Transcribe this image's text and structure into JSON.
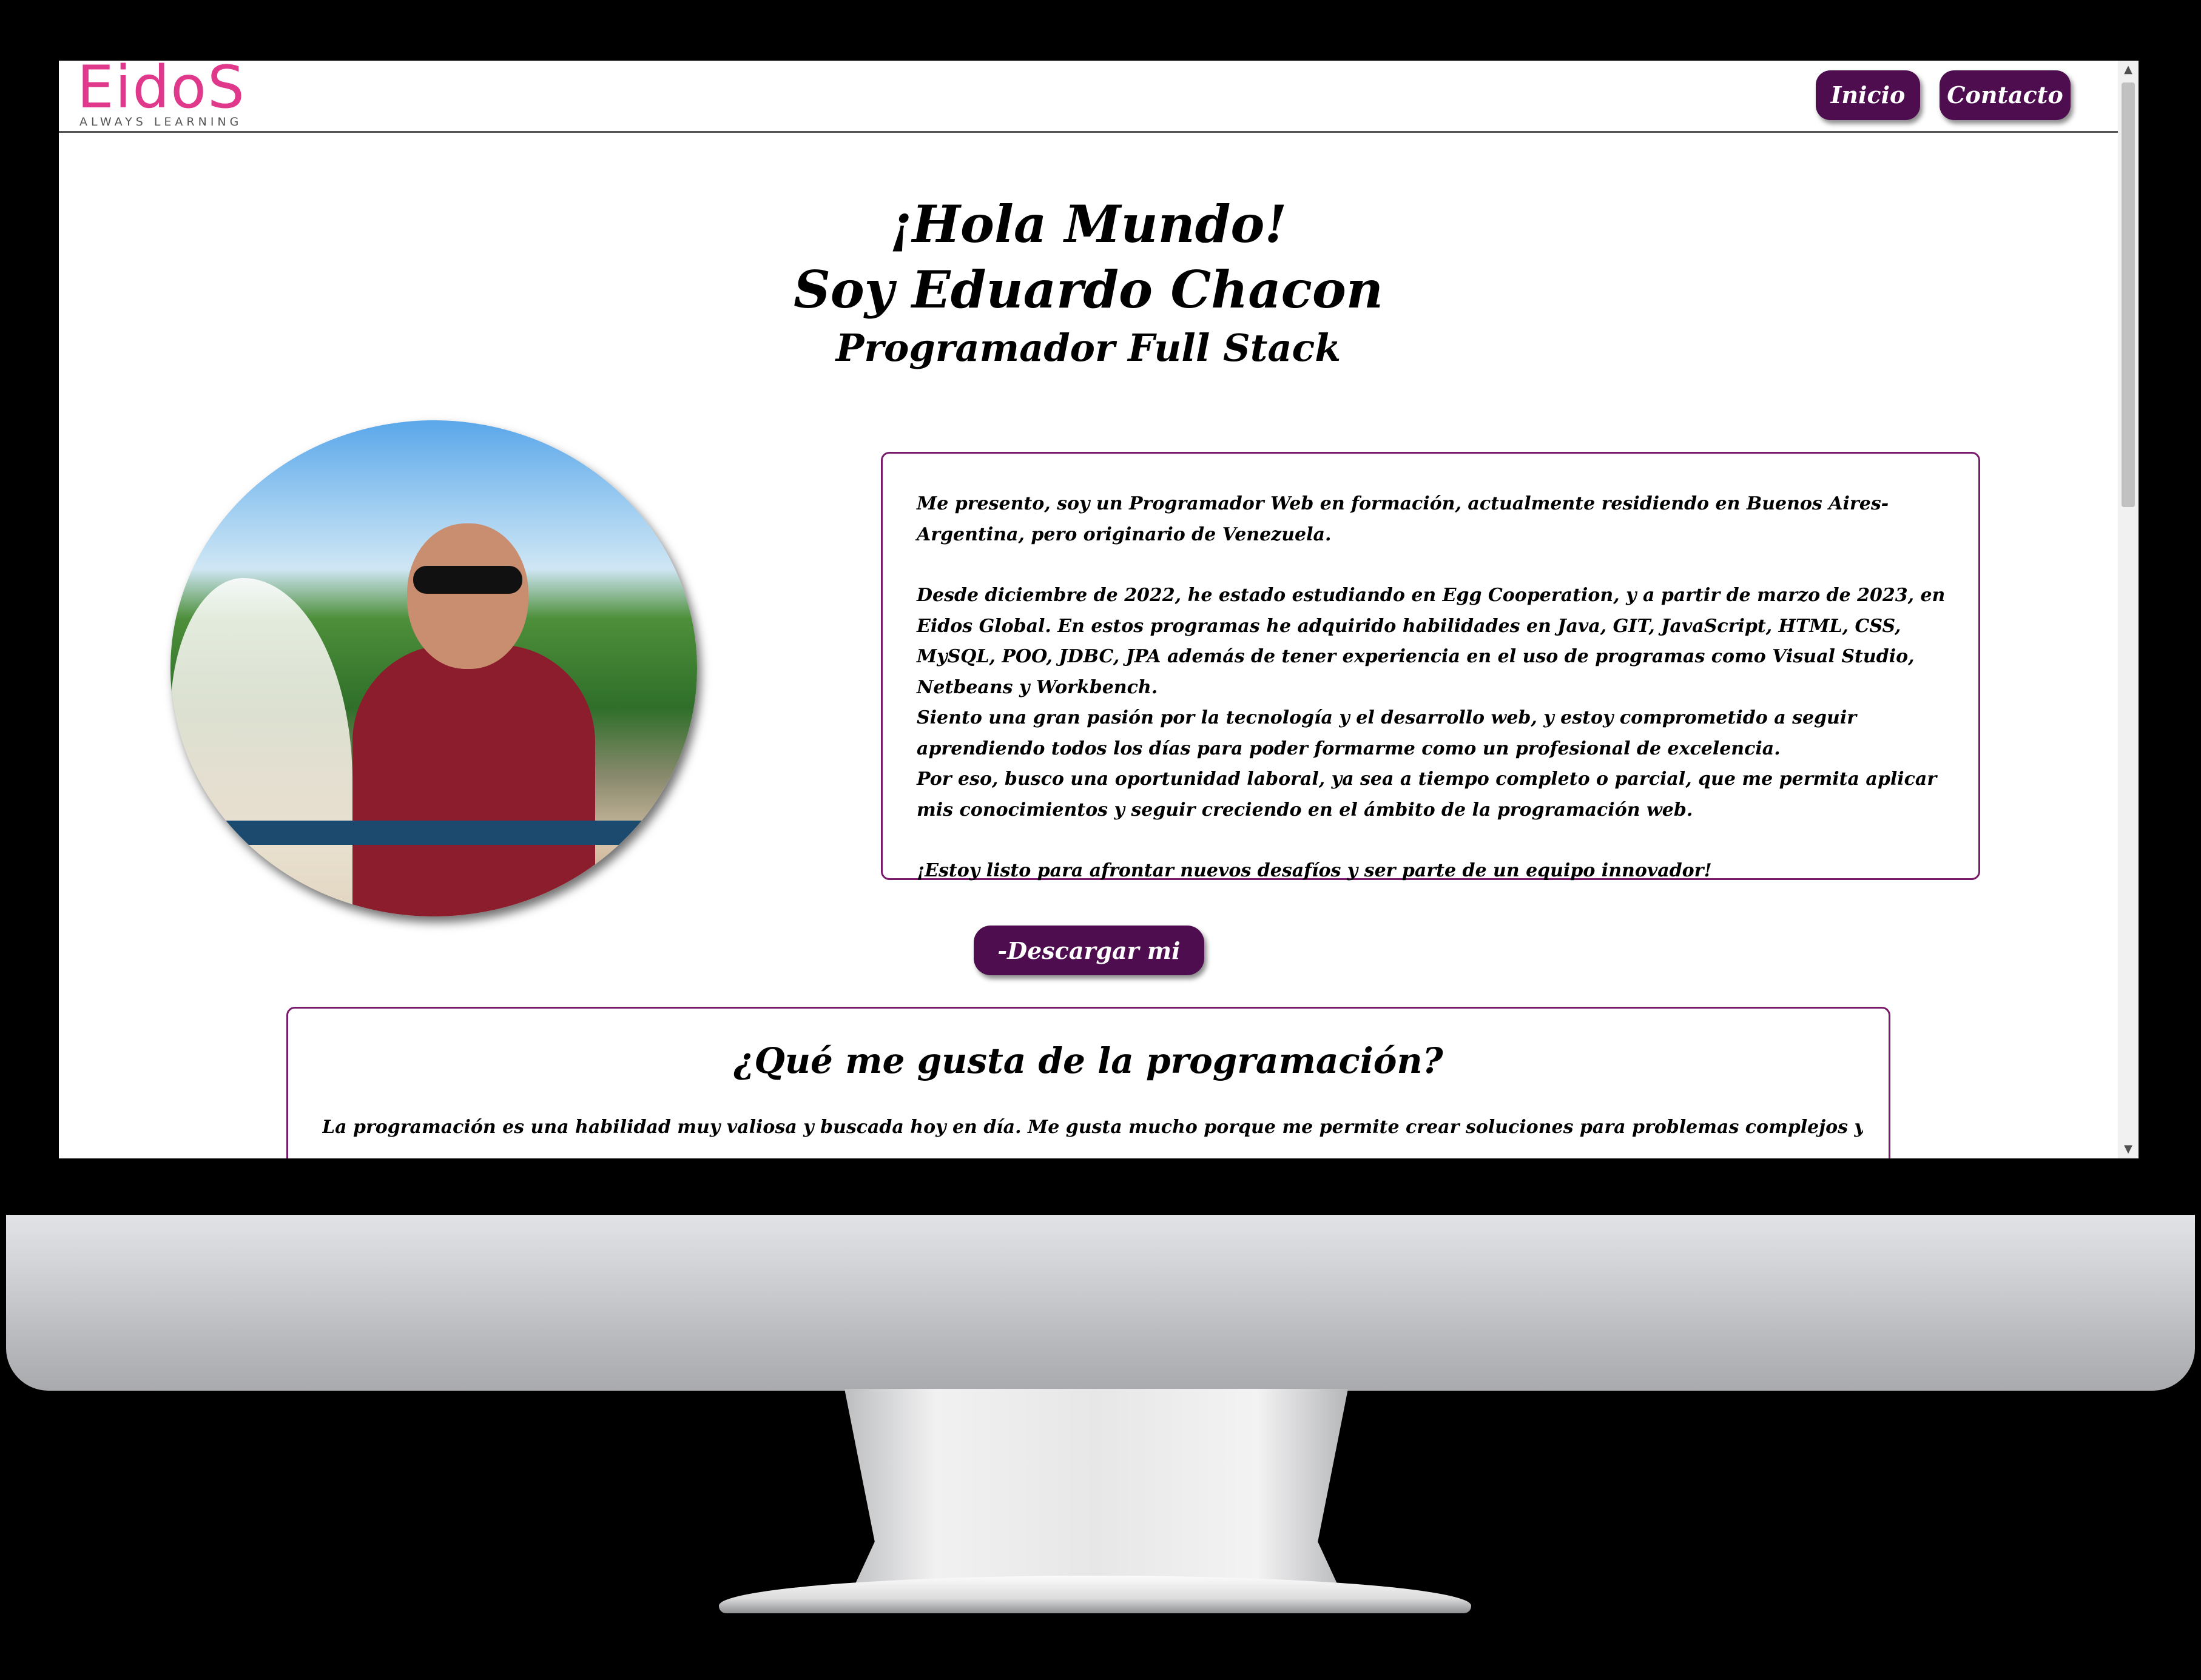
{
  "header": {
    "logo_text": "EidoS",
    "logo_tagline": "ALWAYS LEARNING",
    "nav": {
      "inicio_label": "Inicio",
      "contacto_label": "Contacto"
    }
  },
  "hero": {
    "line1": "¡Hola Mundo!",
    "line2": "Soy Eduardo Chacon",
    "line3": "Programador Full Stack"
  },
  "about": {
    "paragraph1": "Me presento, soy un Programador Web en formación, actualmente residiendo en Buenos Aires-Argentina, pero originario de Venezuela.",
    "paragraph2": "Desde diciembre de 2022, he estado estudiando en Egg Cooperation, y a partir de marzo de 2023, en Eidos Global. En estos programas he adquirido habilidades en Java, GIT, JavaScript, HTML, CSS, MySQL, POO, JDBC, JPA además de tener experiencia en el uso de programas como Visual Studio, Netbeans y Workbench.\nSiento una gran pasión por la tecnología y el desarrollo web, y estoy comprometido a seguir aprendiendo todos los días para poder formarme como un profesional de excelencia.\nPor eso, busco una oportunidad laboral, ya sea a tiempo completo o parcial, que me permita aplicar mis conocimientos y seguir creciendo en el ámbito de la programación web.",
    "paragraph3": "¡Estoy listo para afrontar nuevos desafíos y ser parte de un equipo innovador!"
  },
  "cv_button_label": "-Descargar mi CV-",
  "programming": {
    "title": "¿Qué me gusta de la programación?",
    "text": "La programación es una habilidad muy valiosa y buscada hoy en día. Me gusta mucho porque me permite crear soluciones para problemas complejos y crear nuevas aplicaciones que"
  },
  "colors": {
    "accent": "#4d0d4f",
    "border": "#7a1a6b",
    "logo": "#e0388b"
  },
  "icons": {
    "scroll_up": "▲",
    "scroll_down": "▼"
  }
}
